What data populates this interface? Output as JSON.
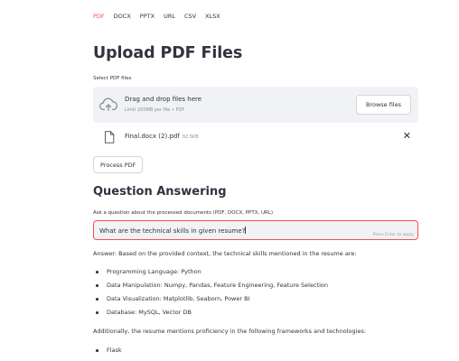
{
  "tabs": [
    "PDF",
    "DOCX",
    "PPTX",
    "URL",
    "CSV",
    "XLSX"
  ],
  "active_tab": 0,
  "page_title": "Upload PDF Files",
  "uploader": {
    "label": "Select PDF files",
    "drop_title": "Drag and drop files here",
    "drop_limit": "Limit 200MB per file • PDF",
    "browse_label": "Browse files"
  },
  "file": {
    "name": "Final.docx (2).pdf",
    "size": "92.5KB",
    "remove_icon": "✕"
  },
  "process_button": "Process PDF",
  "qa": {
    "title": "Question Answering",
    "label": "Ask a question about the processed documents (PDF, DOCX, PPTX, URL)",
    "input_value": "What are the technical skills in given resume?",
    "hint": "Press Enter to apply"
  },
  "answer": {
    "intro": "Answer: Based on the provided context, the technical skills mentioned in the resume are:",
    "bullets": [
      "Programming Language: Python",
      "Data Manipulation: Numpy, Pandas, Feature Engineering, Feature Selection",
      "Data Visualization: Matplotlib, Seaborn, Power BI",
      "Database: MySQL, Vector DB"
    ],
    "additional": "Additionally, the resume mentions proficiency in the following frameworks and technologies:",
    "more_bullets": [
      "Flask"
    ]
  },
  "colors": {
    "accent": "#ff4b4b",
    "text": "#31333f",
    "muted": "#8e9098",
    "panel": "#f0f2f6"
  },
  "icons": {
    "upload": "cloud-upload-icon",
    "file": "file-icon",
    "remove": "close-icon"
  }
}
